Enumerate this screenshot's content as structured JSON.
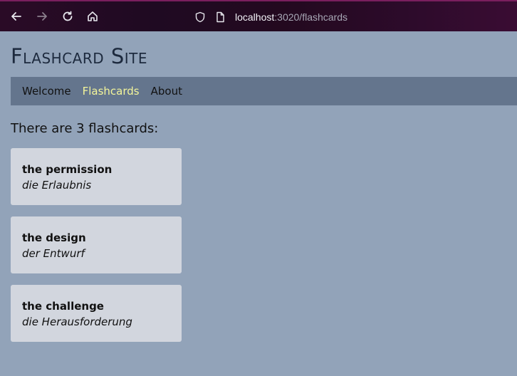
{
  "browser": {
    "url_host": "localhost",
    "url_rest": ":3020/flashcards"
  },
  "site": {
    "title": "Flashcard Site"
  },
  "nav": {
    "items": [
      {
        "label": "Welcome",
        "active": false
      },
      {
        "label": "Flashcards",
        "active": true
      },
      {
        "label": "About",
        "active": false
      }
    ]
  },
  "main": {
    "heading": "There are 3 flashcards:",
    "cards": [
      {
        "front": "the permission",
        "back": "die Erlaubnis"
      },
      {
        "front": "the design",
        "back": "der Entwurf"
      },
      {
        "front": "the challenge",
        "back": "die Herausforderung"
      }
    ]
  },
  "colors": {
    "page_bg": "#92a3b9",
    "nav_bg": "#64758d",
    "nav_active": "#f3f59a",
    "card_bg": "#d2d6de"
  }
}
